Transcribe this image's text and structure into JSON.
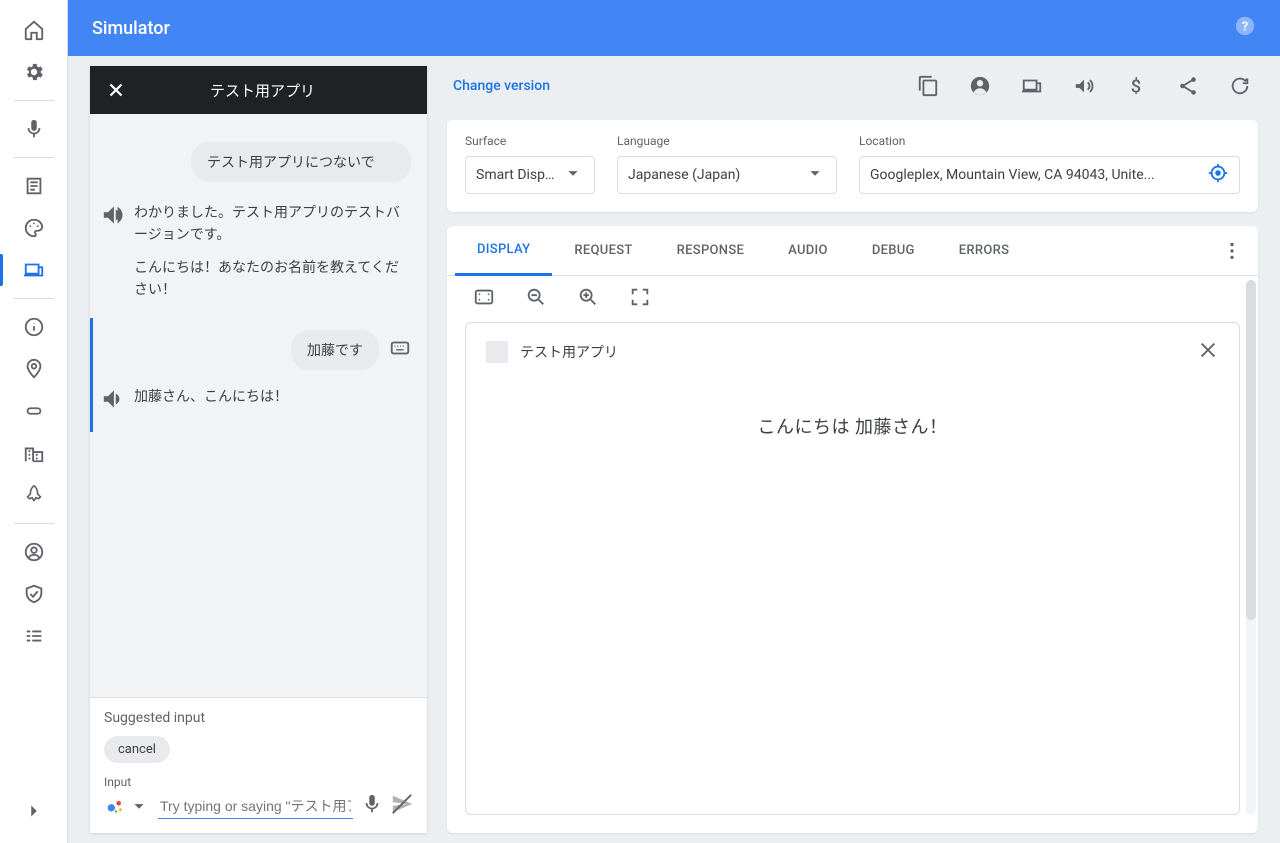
{
  "page_title": "Simulator",
  "leftnav": {
    "items": [
      "home",
      "settings",
      "mic",
      "notes",
      "palette",
      "devices",
      "info",
      "location",
      "chip",
      "business",
      "rocket",
      "account",
      "shield",
      "list"
    ],
    "active_index": 5
  },
  "chat": {
    "title": "テスト用アプリ",
    "messages": [
      {
        "type": "user_bubble",
        "text": "テスト用アプリにつないで"
      },
      {
        "type": "assistant",
        "paragraphs": [
          "わかりました。テスト用アプリのテストバージョンです。",
          "こんにちは！あなたのお名前を教えてください！"
        ]
      },
      {
        "type": "user_row",
        "text": "加藤です"
      },
      {
        "type": "assistant_short",
        "text": "加藤さん、こんにちは！"
      }
    ],
    "suggested_label": "Suggested input",
    "suggested_chip": "cancel",
    "input_label": "Input",
    "input_placeholder": "Try typing or saying \"テスト用アプ"
  },
  "controls": {
    "change_version": "Change version",
    "icons": [
      "copy",
      "account",
      "smart-display",
      "volume",
      "dollar",
      "share",
      "refresh"
    ]
  },
  "settings": {
    "surface": {
      "label": "Surface",
      "value": "Smart Displ…"
    },
    "language": {
      "label": "Language",
      "value": "Japanese (Japan)"
    },
    "location": {
      "label": "Location",
      "value": "Googleplex, Mountain View, CA 94043, Unite..."
    }
  },
  "tabs": {
    "items": [
      "DISPLAY",
      "REQUEST",
      "RESPONSE",
      "AUDIO",
      "DEBUG",
      "ERRORS"
    ],
    "active_index": 0
  },
  "device": {
    "app_name": "テスト用アプリ",
    "message": "こんにちは 加藤さん！"
  }
}
